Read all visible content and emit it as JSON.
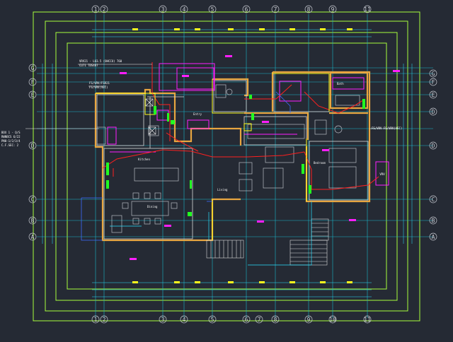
{
  "drawing": {
    "background": "#252a34",
    "colors": {
      "frame": "#a8ff3c",
      "axis": "#19b6c9",
      "wall": "#e8a640",
      "wall_inner": "#d9d9d9",
      "yellow": "#ffff1e",
      "magenta": "#ff1eff",
      "red": "#ff2020",
      "green": "#21ff21",
      "cyan": "#28e0ff",
      "blue": "#3b6bff",
      "white": "#f0f0f0",
      "furniture": "#b8bcc4"
    }
  },
  "grid": {
    "columns": [
      "1",
      "2",
      "3",
      "4",
      "5",
      "6",
      "7",
      "8",
      "9",
      "10",
      "11"
    ],
    "rows": [
      "G",
      "F",
      "E",
      "D",
      "C",
      "B",
      "A"
    ]
  },
  "rooms": {
    "vrv": "VRV",
    "living": "Living",
    "kitchen": "Kitchen",
    "dining": "Dining",
    "bedroom": "Bedroom",
    "entry": "Entry",
    "bath": "Bath"
  },
  "notes": {
    "top": "VRV21 - LU3.5 (OHCCU) 760",
    "top_sub": "CU71   TDS487",
    "left": "FS/VRV/FSR21",
    "left_sub": "FS/VRV(VEC)",
    "right": "FS/VRV  FS/VRV(VEC)",
    "legend": [
      "BOX 1 - Q/S",
      "RWNBCS 6/22",
      "PN0-1/2/3/4",
      "C.F.SEC: 2"
    ]
  },
  "icons": [
    "vrv-unit-icon",
    "fan-coil-icon",
    "control-panel-icon"
  ]
}
